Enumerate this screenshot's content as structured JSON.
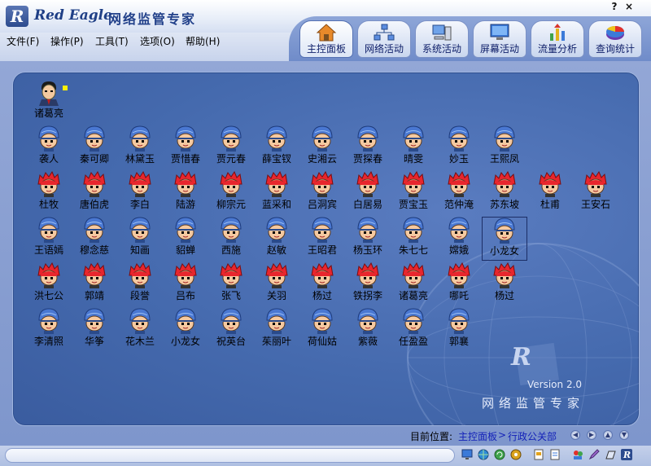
{
  "app": {
    "brand_en": "Red Eagle",
    "brand_cn": "网络监管专家",
    "logo_letter": "R",
    "help_glyph": "?",
    "close_glyph": "×"
  },
  "menu": [
    "文件(F)",
    "操作(P)",
    "工具(T)",
    "选项(O)",
    "帮助(H)"
  ],
  "toolbar": [
    {
      "label": "主控面板",
      "icon": "home-icon",
      "active": true
    },
    {
      "label": "网络活动",
      "icon": "network-icon",
      "active": false
    },
    {
      "label": "系统活动",
      "icon": "computer-icon",
      "active": false
    },
    {
      "label": "屏幕活动",
      "icon": "monitor-icon",
      "active": false
    },
    {
      "label": "流量分析",
      "icon": "traffic-icon",
      "active": false
    },
    {
      "label": "查询统计",
      "icon": "pie-chart-icon",
      "active": false
    }
  ],
  "admin": {
    "name": "诸葛亮",
    "icon": "admin-avatar-icon"
  },
  "users": [
    {
      "name": "袭人",
      "type": "helmet"
    },
    {
      "name": "秦可卿",
      "type": "helmet"
    },
    {
      "name": "林黛玉",
      "type": "helmet"
    },
    {
      "name": "贾惜春",
      "type": "helmet"
    },
    {
      "name": "贾元春",
      "type": "helmet"
    },
    {
      "name": "薛宝钗",
      "type": "helmet"
    },
    {
      "name": "史湘云",
      "type": "helmet"
    },
    {
      "name": "贾探春",
      "type": "helmet"
    },
    {
      "name": "晴雯",
      "type": "helmet"
    },
    {
      "name": "妙玉",
      "type": "helmet"
    },
    {
      "name": "王熙凤",
      "type": "helmet"
    },
    {
      "name": "杜牧",
      "type": "redhair"
    },
    {
      "name": "唐伯虎",
      "type": "redhair"
    },
    {
      "name": "李白",
      "type": "redhair"
    },
    {
      "name": "陆游",
      "type": "redhair"
    },
    {
      "name": "柳宗元",
      "type": "redhair"
    },
    {
      "name": "蓝采和",
      "type": "redhair"
    },
    {
      "name": "吕洞宾",
      "type": "redhair"
    },
    {
      "name": "白居易",
      "type": "redhair"
    },
    {
      "name": "贾宝玉",
      "type": "redhair"
    },
    {
      "name": "范仲淹",
      "type": "redhair"
    },
    {
      "name": "苏东坡",
      "type": "redhair"
    },
    {
      "name": "杜甫",
      "type": "redhair"
    },
    {
      "name": "王安石",
      "type": "redhair"
    },
    {
      "name": "王语嫣",
      "type": "helmet"
    },
    {
      "name": "穆念慈",
      "type": "helmet"
    },
    {
      "name": "知画",
      "type": "helmet"
    },
    {
      "name": "貂蝉",
      "type": "helmet"
    },
    {
      "name": "西施",
      "type": "helmet"
    },
    {
      "name": "赵敏",
      "type": "helmet"
    },
    {
      "name": "王昭君",
      "type": "helmet"
    },
    {
      "name": "杨玉环",
      "type": "helmet"
    },
    {
      "name": "朱七七",
      "type": "helmet"
    },
    {
      "name": "嫦娥",
      "type": "helmet"
    },
    {
      "name": "小龙女",
      "type": "helmet",
      "selected": true
    },
    {
      "name": "洪七公",
      "type": "redhair"
    },
    {
      "name": "郭靖",
      "type": "redhair"
    },
    {
      "name": "段誉",
      "type": "redhair"
    },
    {
      "name": "吕布",
      "type": "redhair"
    },
    {
      "name": "张飞",
      "type": "redhair"
    },
    {
      "name": "关羽",
      "type": "redhair"
    },
    {
      "name": "杨过",
      "type": "redhair"
    },
    {
      "name": "铁拐李",
      "type": "redhair"
    },
    {
      "name": "诸葛亮",
      "type": "redhair"
    },
    {
      "name": "哪吒",
      "type": "redhair"
    },
    {
      "name": "杨过",
      "type": "redhair"
    },
    {
      "name": "李清照",
      "type": "helmet"
    },
    {
      "name": "华筝",
      "type": "helmet"
    },
    {
      "name": "花木兰",
      "type": "helmet"
    },
    {
      "name": "小龙女",
      "type": "helmet"
    },
    {
      "name": "祝英台",
      "type": "helmet"
    },
    {
      "name": "茱丽叶",
      "type": "helmet"
    },
    {
      "name": "荷仙姑",
      "type": "helmet"
    },
    {
      "name": "紫薇",
      "type": "helmet"
    },
    {
      "name": "任盈盈",
      "type": "helmet"
    },
    {
      "name": "郭襄",
      "type": "helmet"
    }
  ],
  "watermark": {
    "version": "Version 2.0",
    "title_cn": "网络监管专家",
    "logo_letter": "R"
  },
  "location": {
    "label": "目前位置:",
    "crumb1": "主控面板",
    "separator": ">",
    "crumb2": "行政公关部"
  },
  "nav_buttons": [
    "back-icon",
    "forward-icon",
    "up-icon",
    "down-icon"
  ],
  "status_icons": [
    "monitor-icon",
    "network-globe-icon",
    "refresh-icon",
    "settings-icon",
    "document-icon",
    "print-icon",
    "users-icon",
    "pencil-icon",
    "window-icon",
    "logo-icon"
  ],
  "colors": {
    "panel": "#456aae",
    "header": "#dfe6f4",
    "link": "#1422b8",
    "brand": "#1f3f86"
  }
}
